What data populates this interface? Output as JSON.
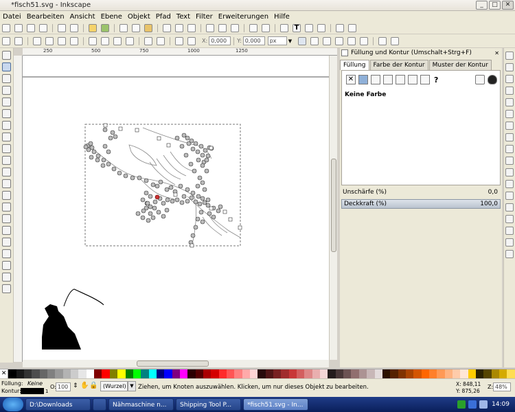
{
  "window": {
    "title": "*fisch51.svg - Inkscape"
  },
  "menu": [
    "Datei",
    "Bearbeiten",
    "Ansicht",
    "Ebene",
    "Objekt",
    "Pfad",
    "Text",
    "Filter",
    "Erweiterungen",
    "Hilfe"
  ],
  "controls": {
    "x_label": "X:",
    "x_value": "0,000",
    "y_label": "Y:",
    "y_value": "0,000",
    "unit": "px"
  },
  "ruler": {
    "ticks": [
      "250",
      "500",
      "750",
      "1000",
      "1250"
    ]
  },
  "panel": {
    "title": "Füllung und Kontur (Umschalt+Strg+F)",
    "tabs": [
      "Füllung",
      "Farbe der Kontur",
      "Muster der Kontur"
    ],
    "fill_status": "Keine Farbe",
    "help_glyph": "?",
    "blur_label": "Unschärfe (%)",
    "blur_value": "0,0",
    "opacity_label": "Deckkraft (%)",
    "opacity_value": "100,0"
  },
  "status": {
    "fill_label": "Füllung:",
    "fill_value": "Keine",
    "stroke_label": "Kontur:",
    "stroke_width": "1",
    "opacity_label": "O:",
    "opacity_value": "100",
    "layer": "(Wurzel)",
    "message": "Ziehen, um Knoten auszuwählen. Klicken, um nur dieses Objekt zu bearbeiten.",
    "x_coord": "X:  848,11",
    "y_coord": "Y:  875,26",
    "zoom_label": "Z:",
    "zoom_value": "48%"
  },
  "taskbar": {
    "items": [
      "D:\\Downloads",
      "Nähmaschine n...",
      "Shipping Tool P...",
      "*fisch51.svg - In..."
    ],
    "clock": "14:09"
  },
  "colors": {
    "accent": "#3c5fa8",
    "node_red": "#cc3333"
  }
}
